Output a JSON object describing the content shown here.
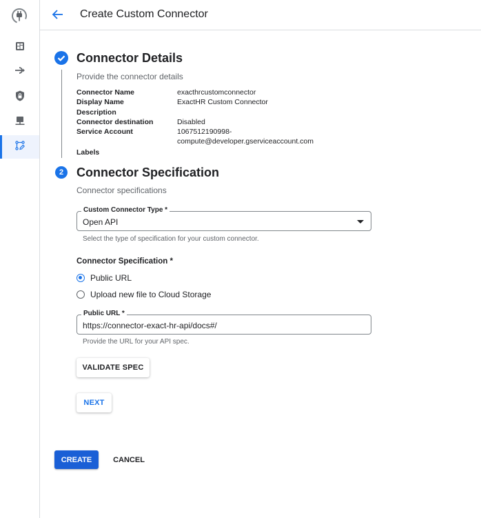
{
  "header": {
    "title": "Create Custom Connector"
  },
  "rail": {
    "items": [
      {
        "icon": "dashboard-icon"
      },
      {
        "icon": "connection-icon"
      },
      {
        "icon": "security-shield-icon"
      },
      {
        "icon": "desktop-network-icon"
      },
      {
        "icon": "custom-connector-icon",
        "active": true
      }
    ]
  },
  "step1": {
    "status": "completed",
    "title": "Connector Details",
    "subtitle": "Provide the connector details",
    "details": [
      {
        "key": "Connector Name",
        "value": "exacthrcustomconnector"
      },
      {
        "key": "Display Name",
        "value": "ExactHR Custom Connector"
      },
      {
        "key": "Description",
        "value": ""
      },
      {
        "key": "Connector destination",
        "value": "Disabled"
      },
      {
        "key": "Service Account",
        "value": "1067512190998-",
        "value2": "compute@developer.gserviceaccount.com"
      },
      {
        "key": "Labels",
        "value": ""
      }
    ]
  },
  "step2": {
    "number": "2",
    "title": "Connector Specification",
    "subtitle": "Connector specifications",
    "type_field": {
      "label": "Custom Connector Type *",
      "value": "Open API",
      "hint": "Select the type of specification for your custom connector."
    },
    "spec_group": {
      "label": "Connector Specification *",
      "options": [
        {
          "label": "Public URL",
          "checked": true
        },
        {
          "label": "Upload new file to Cloud Storage",
          "checked": false
        }
      ]
    },
    "url_field": {
      "label": "Public URL *",
      "value": "https://connector-exact-hr-api/docs#/",
      "hint": "Provide the URL for your API spec."
    },
    "validate_label": "VALIDATE SPEC",
    "next_label": "NEXT"
  },
  "footer": {
    "create_label": "CREATE",
    "cancel_label": "CANCEL"
  },
  "colors": {
    "accent": "#1a73e8",
    "create_button": "#1a5fd6",
    "rail_active_bg": "#eef3fd"
  }
}
